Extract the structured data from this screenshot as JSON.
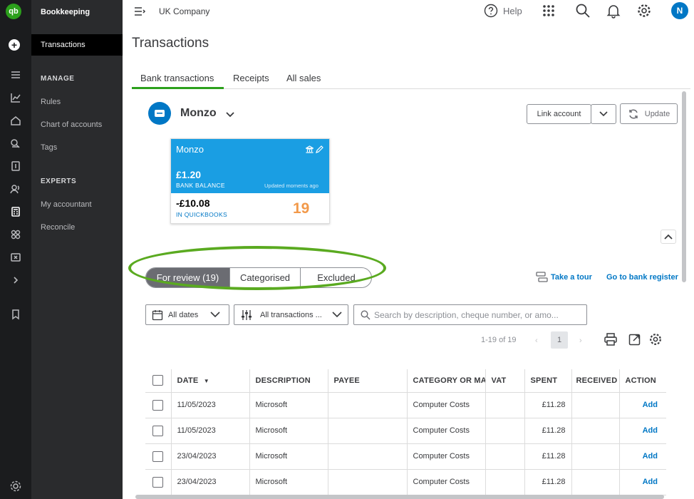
{
  "app": {
    "brand_short": "qb",
    "section": "Bookkeeping",
    "company": "UK Company",
    "help_label": "Help",
    "avatar_initial": "N"
  },
  "sidenav": {
    "active": "Transactions",
    "manage_heading": "MANAGE",
    "manage_items": [
      "Rules",
      "Chart of accounts",
      "Tags"
    ],
    "experts_heading": "EXPERTS",
    "experts_items": [
      "My accountant",
      "Reconcile"
    ]
  },
  "page": {
    "title": "Transactions",
    "tabs": [
      "Bank transactions",
      "Receipts",
      "All sales"
    ],
    "active_tab": "Bank transactions"
  },
  "account": {
    "name": "Monzo",
    "link_account_label": "Link account",
    "update_label": "Update"
  },
  "card": {
    "name": "Monzo",
    "bank_balance": "£1.20",
    "bank_balance_label": "BANK BALANCE",
    "updated_text": "Updated moments ago",
    "qb_balance": "-£10.08",
    "qb_balance_label": "IN QUICKBOOKS",
    "pending_count": "19"
  },
  "filters": {
    "segments": [
      "For review (19)",
      "Categorised",
      "Excluded"
    ],
    "active_segment": "For review (19)",
    "take_tour": "Take a tour",
    "bank_register": "Go to bank register",
    "dates_value": "All dates",
    "transactions_value": "All transactions ...",
    "search_placeholder": "Search by description, cheque number, or amo..."
  },
  "pager": {
    "range": "1-19 of 19",
    "page": "1"
  },
  "table": {
    "columns": [
      "DATE",
      "DESCRIPTION",
      "PAYEE",
      "CATEGORY OR MA",
      "VAT",
      "SPENT",
      "RECEIVED",
      "ACTION"
    ],
    "rows": [
      {
        "date": "11/05/2023",
        "description": "Microsoft",
        "payee": "",
        "category": "Computer Costs",
        "vat": "",
        "spent": "£11.28",
        "received": "",
        "action": "Add"
      },
      {
        "date": "11/05/2023",
        "description": "Microsoft",
        "payee": "",
        "category": "Computer Costs",
        "vat": "",
        "spent": "£11.28",
        "received": "",
        "action": "Add"
      },
      {
        "date": "23/04/2023",
        "description": "Microsoft",
        "payee": "",
        "category": "Computer Costs",
        "vat": "",
        "spent": "£11.28",
        "received": "",
        "action": "Add"
      },
      {
        "date": "23/04/2023",
        "description": "Microsoft",
        "payee": "",
        "category": "Computer Costs",
        "vat": "",
        "spent": "£11.28",
        "received": "",
        "action": "Add"
      }
    ]
  },
  "colors": {
    "brand_green": "#2ca01c",
    "link_blue": "#0077c5",
    "card_blue": "#1a9ee3",
    "pending_orange": "#f2994a",
    "highlight_oval": "#5aaa20",
    "rail_bg": "#1b1c1e",
    "nav_bg": "#2a2b2d"
  }
}
